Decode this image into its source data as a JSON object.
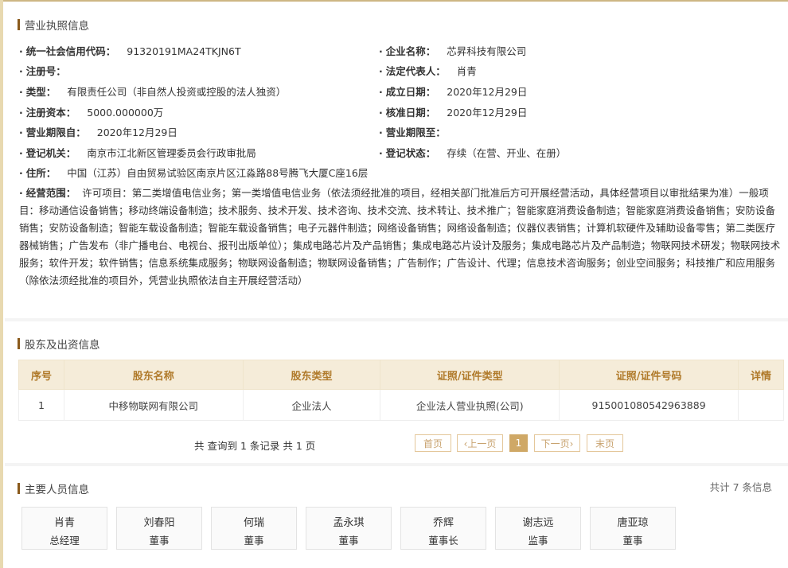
{
  "license": {
    "title": "营业执照信息",
    "credit_code": {
      "label": "统一社会信用代码：",
      "value": "91320191MA24TKJN6T"
    },
    "company_name": {
      "label": "企业名称：",
      "value": "芯昇科技有限公司"
    },
    "reg_no": {
      "label": "注册号：",
      "value": ""
    },
    "legal_rep": {
      "label": "法定代表人：",
      "value": "肖青"
    },
    "type": {
      "label": "类型：",
      "value": "有限责任公司（非自然人投资或控股的法人独资）"
    },
    "established": {
      "label": "成立日期：",
      "value": "2020年12月29日"
    },
    "capital": {
      "label": "注册资本：",
      "value": "5000.000000万"
    },
    "approved": {
      "label": "核准日期：",
      "value": "2020年12月29日"
    },
    "term_from": {
      "label": "营业期限自：",
      "value": "2020年12月29日"
    },
    "term_to": {
      "label": "营业期限至：",
      "value": ""
    },
    "authority": {
      "label": "登记机关：",
      "value": "南京市江北新区管理委员会行政审批局"
    },
    "status": {
      "label": "登记状态：",
      "value": "存续（在营、开业、在册）"
    },
    "address": {
      "label": "住所：",
      "value": "中国（江苏）自由贸易试验区南京片区江淼路88号腾飞大厦C座16层"
    },
    "scope": {
      "label": "经营范围：",
      "value": "许可项目：第二类增值电信业务；第一类增值电信业务（依法须经批准的项目，经相关部门批准后方可开展经营活动，具体经营项目以审批结果为准）一般项目：移动通信设备销售；移动终端设备制造；技术服务、技术开发、技术咨询、技术交流、技术转让、技术推广；智能家庭消费设备制造；智能家庭消费设备销售；安防设备销售；安防设备制造；智能车载设备制造；智能车载设备销售；电子元器件制造；网络设备销售；网络设备制造；仪器仪表销售；计算机软硬件及辅助设备零售；第二类医疗器械销售；广告发布（非广播电台、电视台、报刊出版单位）；集成电路芯片及产品销售；集成电路芯片设计及服务；集成电路芯片及产品制造；物联网技术研发；物联网技术服务；软件开发；软件销售；信息系统集成服务；物联网设备制造；物联网设备销售；广告制作；广告设计、代理；信息技术咨询服务；创业空间服务；科技推广和应用服务（除依法须经批准的项目外，凭营业执照依法自主开展经营活动）"
    }
  },
  "shareholders": {
    "title": "股东及出资信息",
    "headers": [
      "序号",
      "股东名称",
      "股东类型",
      "证照/证件类型",
      "证照/证件号码",
      "详情"
    ],
    "rows": [
      [
        "1",
        "中移物联网有限公司",
        "企业法人",
        "企业法人营业执照(公司)",
        "915001080542963889",
        ""
      ]
    ],
    "pager": {
      "summary": "共 查询到 1 条记录 共 1 页",
      "first": "首页",
      "prev": "‹上一页",
      "current": "1",
      "next": "下一页›",
      "last": "末页"
    }
  },
  "people": {
    "title": "主要人员信息",
    "total": "共计 7 条信息",
    "items": [
      {
        "name": "肖青",
        "role": "总经理"
      },
      {
        "name": "刘春阳",
        "role": "董事"
      },
      {
        "name": "何瑞",
        "role": "董事"
      },
      {
        "name": "孟永琪",
        "role": "董事"
      },
      {
        "name": "乔辉",
        "role": "董事长"
      },
      {
        "name": "谢志远",
        "role": "监事"
      },
      {
        "name": "唐亚琼",
        "role": "董事"
      }
    ]
  },
  "colors": {
    "accent": "#8a5a1c",
    "header_bg": "#f5ecd9",
    "header_text": "#b07a2a",
    "pager_active": "#cfa866"
  }
}
